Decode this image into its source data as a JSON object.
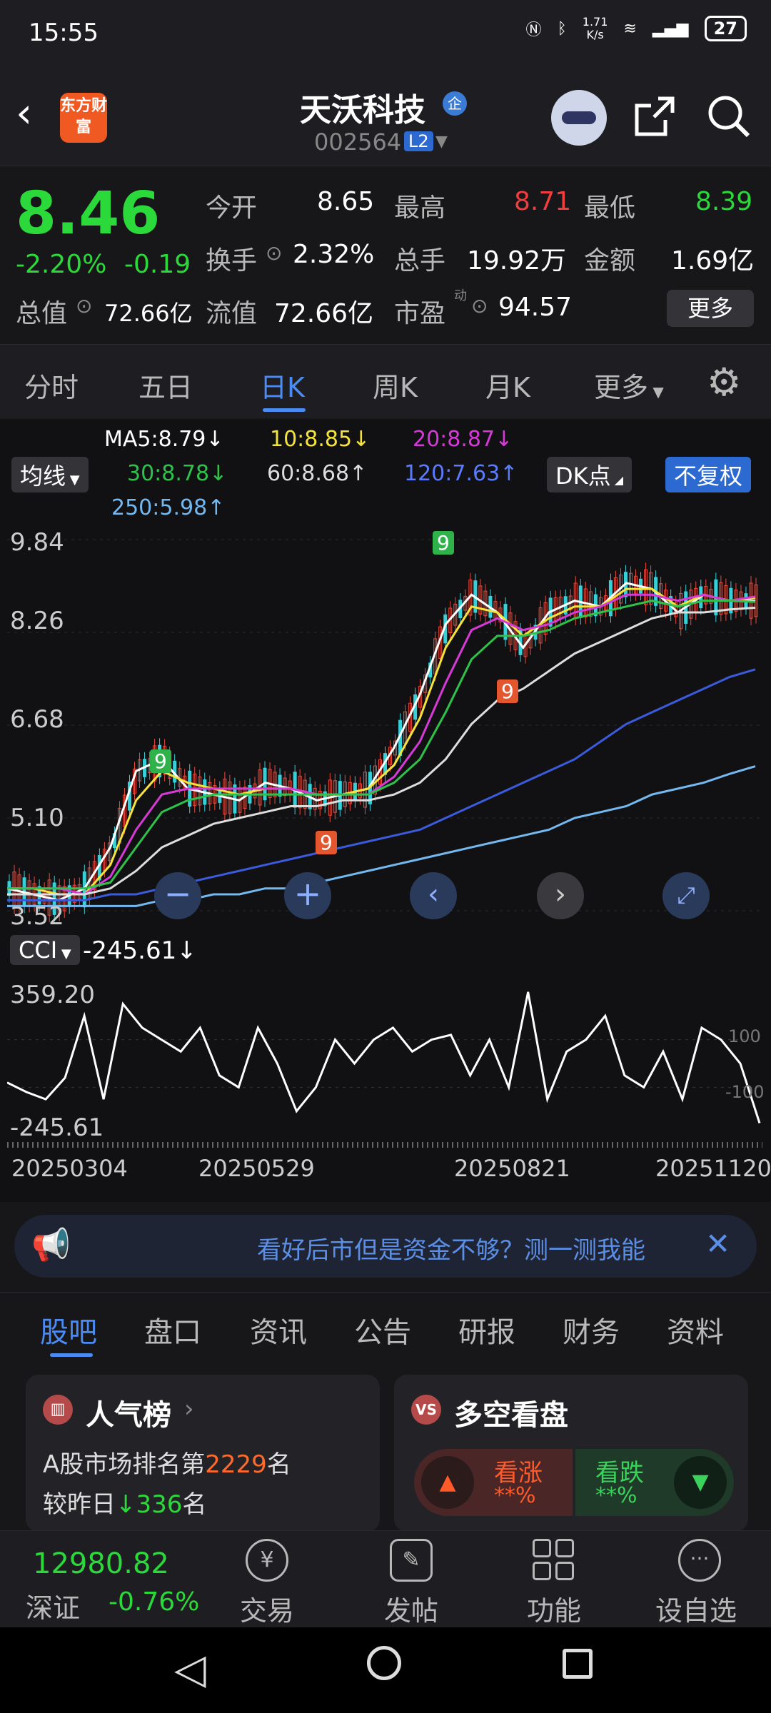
{
  "status": {
    "time": "15:55",
    "net_speed": "1.71",
    "net_unit": "K/s",
    "battery": "27"
  },
  "header": {
    "logo": "东方财富",
    "title": "天沃科技",
    "badge": "企",
    "code": "002564",
    "level": "L2"
  },
  "quote": {
    "price": "8.46",
    "change_pct": "-2.20%",
    "change": "-0.19",
    "open_label": "今开",
    "open": "8.65",
    "high_label": "最高",
    "high": "8.71",
    "low_label": "最低",
    "low": "8.39",
    "turnover_label": "换手",
    "turnover": "2.32%",
    "volume_label": "总手",
    "volume": "19.92万",
    "amount_label": "金额",
    "amount": "1.69亿",
    "mktcap_label": "总值",
    "mktcap": "72.66亿",
    "float_label": "流值",
    "float": "72.66亿",
    "pe_label": "市盈",
    "pe_sup": "动",
    "pe": "94.57",
    "more": "更多"
  },
  "tabs": [
    "分时",
    "五日",
    "日K",
    "周K",
    "月K",
    "更多"
  ],
  "indicators": {
    "ma_select": "均线",
    "ma5": "MA5:8.79↓",
    "ma10": "10:8.85↓",
    "ma20": "20:8.87↓",
    "ma30": "30:8.78↓",
    "ma60": "60:8.68↑",
    "ma120": "120:7.63↑",
    "ma250": "250:5.98↑",
    "dk": "DK点",
    "fq": "不复权",
    "cci_select": "CCI",
    "cci_value": "-245.61↓"
  },
  "colors": {
    "ma5": "#ffffff",
    "ma10": "#f5e33b",
    "ma20": "#d63ad6",
    "ma30": "#2fc24a",
    "ma60": "#dddddd",
    "ma120": "#3b5bdb",
    "ma250": "#74b8f0"
  },
  "chart_data": {
    "type": "line",
    "price_axis": [
      "9.84",
      "8.26",
      "6.68",
      "5.10",
      "3.52"
    ],
    "ylim": [
      3.52,
      9.84
    ],
    "cci_axis": [
      "359.20",
      "100",
      "-100",
      "-245.61"
    ],
    "dates": [
      "20250304",
      "20250529",
      "20250821",
      "20251120"
    ],
    "series": [
      {
        "name": "MA5",
        "values": [
          3.9,
          3.8,
          3.7,
          3.9,
          4.6,
          5.9,
          6.1,
          5.6,
          5.5,
          5.4,
          5.7,
          5.6,
          5.4,
          5.5,
          5.6,
          6.3,
          7.2,
          8.4,
          8.9,
          8.6,
          8.0,
          8.6,
          8.8,
          8.7,
          9.1,
          9.0,
          8.6,
          8.9,
          8.8,
          8.8
        ]
      },
      {
        "name": "MA10",
        "values": [
          3.9,
          3.9,
          3.8,
          3.8,
          4.3,
          5.4,
          5.9,
          5.7,
          5.6,
          5.5,
          5.6,
          5.6,
          5.5,
          5.5,
          5.6,
          6.0,
          6.8,
          8.0,
          8.7,
          8.6,
          8.2,
          8.5,
          8.7,
          8.7,
          9.0,
          9.0,
          8.7,
          8.9,
          8.8,
          8.85
        ]
      },
      {
        "name": "MA20",
        "values": [
          3.9,
          3.9,
          3.9,
          3.8,
          4.1,
          4.9,
          5.5,
          5.6,
          5.6,
          5.6,
          5.6,
          5.6,
          5.5,
          5.5,
          5.5,
          5.8,
          6.4,
          7.4,
          8.3,
          8.5,
          8.3,
          8.4,
          8.6,
          8.7,
          8.9,
          8.9,
          8.8,
          8.9,
          8.8,
          8.87
        ]
      },
      {
        "name": "MA30",
        "values": [
          3.9,
          3.9,
          3.9,
          3.9,
          4.0,
          4.6,
          5.2,
          5.4,
          5.5,
          5.5,
          5.5,
          5.5,
          5.5,
          5.5,
          5.5,
          5.7,
          6.1,
          6.9,
          7.8,
          8.2,
          8.2,
          8.3,
          8.5,
          8.6,
          8.7,
          8.8,
          8.7,
          8.8,
          8.8,
          8.78
        ]
      },
      {
        "name": "MA60",
        "values": [
          3.8,
          3.8,
          3.8,
          3.8,
          3.9,
          4.2,
          4.6,
          4.8,
          5.0,
          5.1,
          5.2,
          5.3,
          5.3,
          5.4,
          5.4,
          5.5,
          5.7,
          6.1,
          6.7,
          7.1,
          7.3,
          7.6,
          7.9,
          8.1,
          8.3,
          8.5,
          8.6,
          8.6,
          8.65,
          8.68
        ]
      },
      {
        "name": "MA120",
        "values": [
          3.7,
          3.7,
          3.7,
          3.7,
          3.8,
          3.8,
          3.9,
          4.0,
          4.1,
          4.2,
          4.3,
          4.4,
          4.5,
          4.6,
          4.7,
          4.8,
          4.9,
          5.1,
          5.3,
          5.5,
          5.7,
          5.9,
          6.1,
          6.4,
          6.7,
          6.9,
          7.1,
          7.3,
          7.5,
          7.63
        ]
      },
      {
        "name": "MA250",
        "values": [
          3.6,
          3.6,
          3.6,
          3.6,
          3.6,
          3.6,
          3.7,
          3.7,
          3.8,
          3.8,
          3.9,
          3.9,
          4.0,
          4.1,
          4.2,
          4.3,
          4.4,
          4.5,
          4.6,
          4.7,
          4.8,
          4.9,
          5.1,
          5.2,
          5.3,
          5.5,
          5.6,
          5.7,
          5.85,
          5.98
        ]
      }
    ],
    "cci_values": [
      -80,
      -120,
      -150,
      -60,
      200,
      -150,
      250,
      150,
      100,
      50,
      150,
      -50,
      -100,
      150,
      0,
      -200,
      -100,
      100,
      0,
      100,
      150,
      50,
      100,
      120,
      -50,
      100,
      -100,
      300,
      -150,
      50,
      100,
      200,
      -50,
      -100,
      50,
      -150,
      150,
      100,
      0,
      -250
    ],
    "highlighted_events": [
      "9",
      "9",
      "9",
      "9"
    ]
  },
  "banner": {
    "text": "看好后市但是资金不够？测一测我能",
    "close": "✕"
  },
  "subtabs": [
    "股吧",
    "盘口",
    "资讯",
    "公告",
    "研报",
    "财务",
    "资料"
  ],
  "cards": {
    "popular": {
      "title": "人气榜",
      "line1_prefix": "A股市场排名第",
      "rank": "2229",
      "line1_suffix": "名",
      "line2_prefix": "较昨日",
      "delta": "336",
      "line2_suffix": "名"
    },
    "vs": {
      "title": "多空看盘",
      "up_label": "看涨",
      "up_value": "**%",
      "down_label": "看跌",
      "down_value": "**%"
    }
  },
  "bottom": {
    "index_value": "12980.82",
    "index_name": "深证",
    "index_change": "-0.76%",
    "items": [
      "交易",
      "发帖",
      "功能",
      "设自选"
    ]
  }
}
